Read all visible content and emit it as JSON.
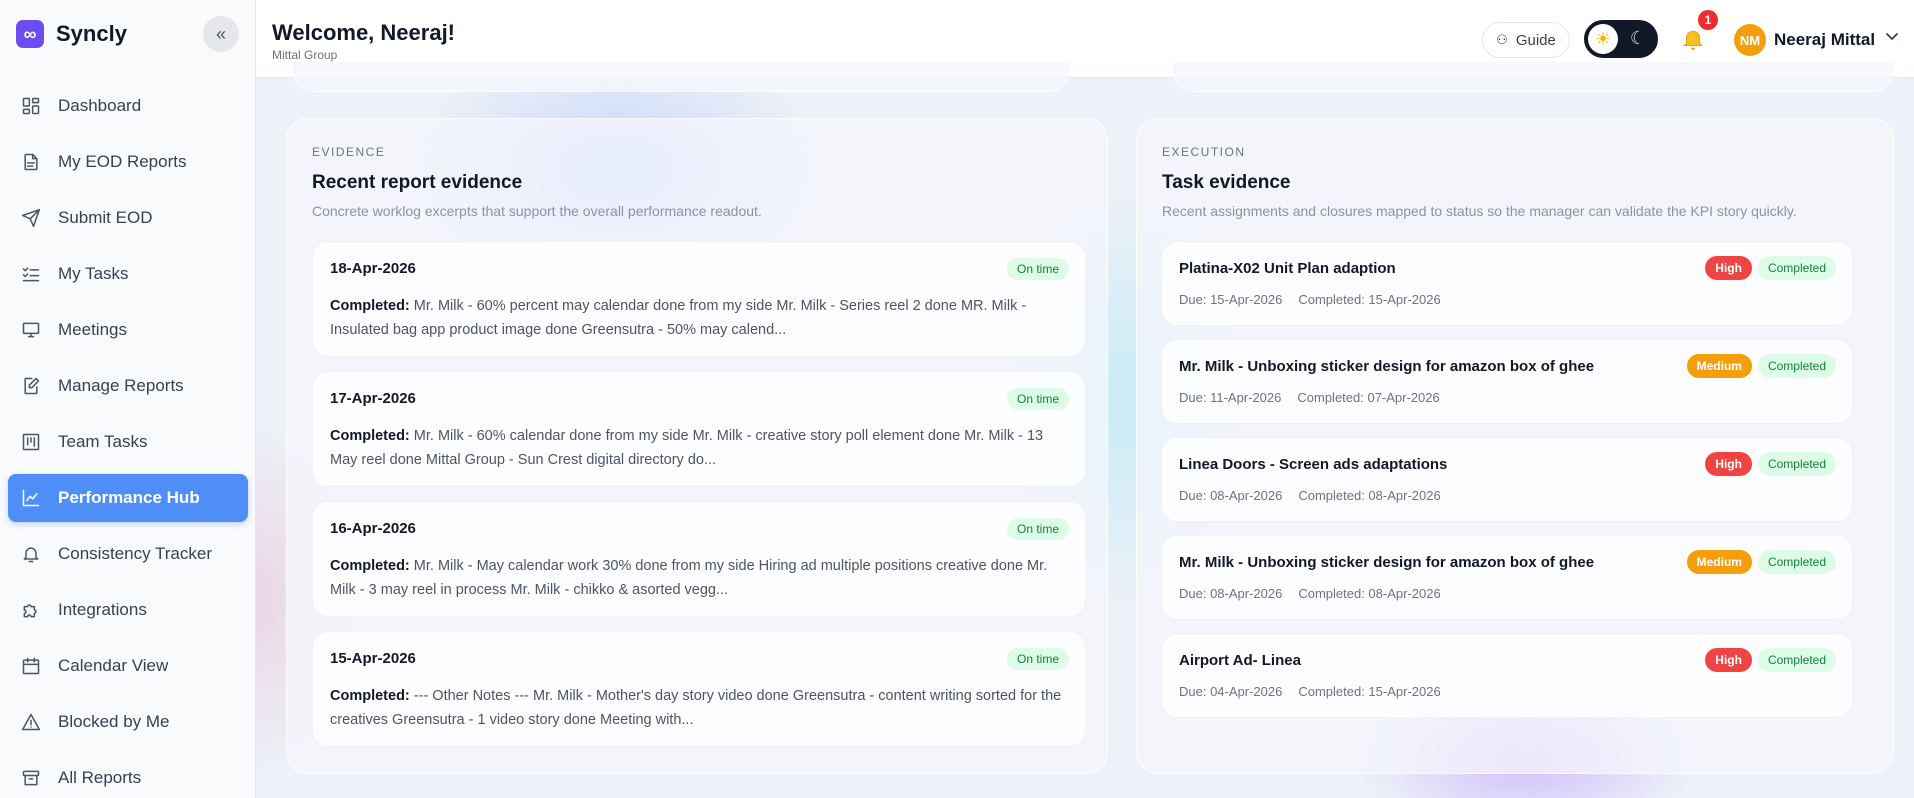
{
  "brand": {
    "name": "Syncly"
  },
  "sidebar": {
    "items": [
      {
        "label": "Dashboard",
        "icon": "dashboard-icon"
      },
      {
        "label": "My EOD Reports",
        "icon": "document-icon"
      },
      {
        "label": "Submit EOD",
        "icon": "send-icon"
      },
      {
        "label": "My Tasks",
        "icon": "checklist-icon"
      },
      {
        "label": "Meetings",
        "icon": "monitor-icon"
      },
      {
        "label": "Manage Reports",
        "icon": "edit-document-icon"
      },
      {
        "label": "Team Tasks",
        "icon": "board-icon"
      },
      {
        "label": "Performance Hub",
        "icon": "chart-line-icon",
        "active": true
      },
      {
        "label": "Consistency Tracker",
        "icon": "bell-icon"
      },
      {
        "label": "Integrations",
        "icon": "puzzle-icon"
      },
      {
        "label": "Calendar View",
        "icon": "calendar-icon"
      },
      {
        "label": "Blocked by Me",
        "icon": "warning-icon"
      },
      {
        "label": "All Reports",
        "icon": "archive-icon"
      }
    ]
  },
  "header": {
    "welcome": "Welcome, Neeraj!",
    "org": "Mittal Group",
    "guide_label": "Guide",
    "notification_count": "1",
    "avatar_initials": "NM",
    "user_name": "Neeraj Mittal"
  },
  "evidence": {
    "eyebrow": "EVIDENCE",
    "title": "Recent report evidence",
    "subtitle": "Concrete worklog excerpts that support the overall performance readout.",
    "items": [
      {
        "date": "18-Apr-2026",
        "status": "On time",
        "label": "Completed:",
        "text": "Mr. Milk - 60% percent may calendar done from my side Mr. Milk - Series reel 2 done MR. Milk - Insulated bag app product image done Greensutra - 50% may calend..."
      },
      {
        "date": "17-Apr-2026",
        "status": "On time",
        "label": "Completed:",
        "text": "Mr. Milk - 60% calendar done from my side Mr. Milk - creative story poll element done Mr. Milk - 13 May reel done Mittal Group - Sun Crest digital directory do..."
      },
      {
        "date": "16-Apr-2026",
        "status": "On time",
        "label": "Completed:",
        "text": "Mr. Milk - May calendar work 30% done from my side Hiring ad multiple positions creative done Mr. Milk - 3 may reel in process Mr. Milk - chikko & asorted vegg..."
      },
      {
        "date": "15-Apr-2026",
        "status": "On time",
        "label": "Completed:",
        "text": "--- Other Notes --- Mr. Milk - Mother's day story video done Greensutra - content writing sorted for the creatives Greensutra - 1 video story done Meeting with..."
      }
    ]
  },
  "execution": {
    "eyebrow": "EXECUTION",
    "title": "Task evidence",
    "subtitle": "Recent assignments and closures mapped to status so the manager can validate the KPI story quickly.",
    "items": [
      {
        "title": "Platina-X02 Unit Plan adaption",
        "priority": "High",
        "status": "Completed",
        "due": "Due: 15-Apr-2026",
        "completed": "Completed: 15-Apr-2026"
      },
      {
        "title": "Mr. Milk - Unboxing sticker design for amazon box of ghee",
        "priority": "Medium",
        "status": "Completed",
        "due": "Due: 11-Apr-2026",
        "completed": "Completed: 07-Apr-2026"
      },
      {
        "title": "Linea Doors - Screen ads adaptations",
        "priority": "High",
        "status": "Completed",
        "due": "Due: 08-Apr-2026",
        "completed": "Completed: 08-Apr-2026"
      },
      {
        "title": "Mr. Milk - Unboxing sticker design for amazon box of ghee",
        "priority": "Medium",
        "status": "Completed",
        "due": "Due: 08-Apr-2026",
        "completed": "Completed: 08-Apr-2026"
      },
      {
        "title": "Airport Ad- Linea",
        "priority": "High",
        "status": "Completed",
        "due": "Due: 04-Apr-2026",
        "completed": "Completed: 15-Apr-2026"
      }
    ]
  },
  "colors": {
    "accent": "#4f8ef7",
    "brand": "#6d4df2",
    "high": "#ef4444",
    "medium": "#f59e0b",
    "success_bg": "#dcfce7",
    "success_fg": "#15803d"
  }
}
